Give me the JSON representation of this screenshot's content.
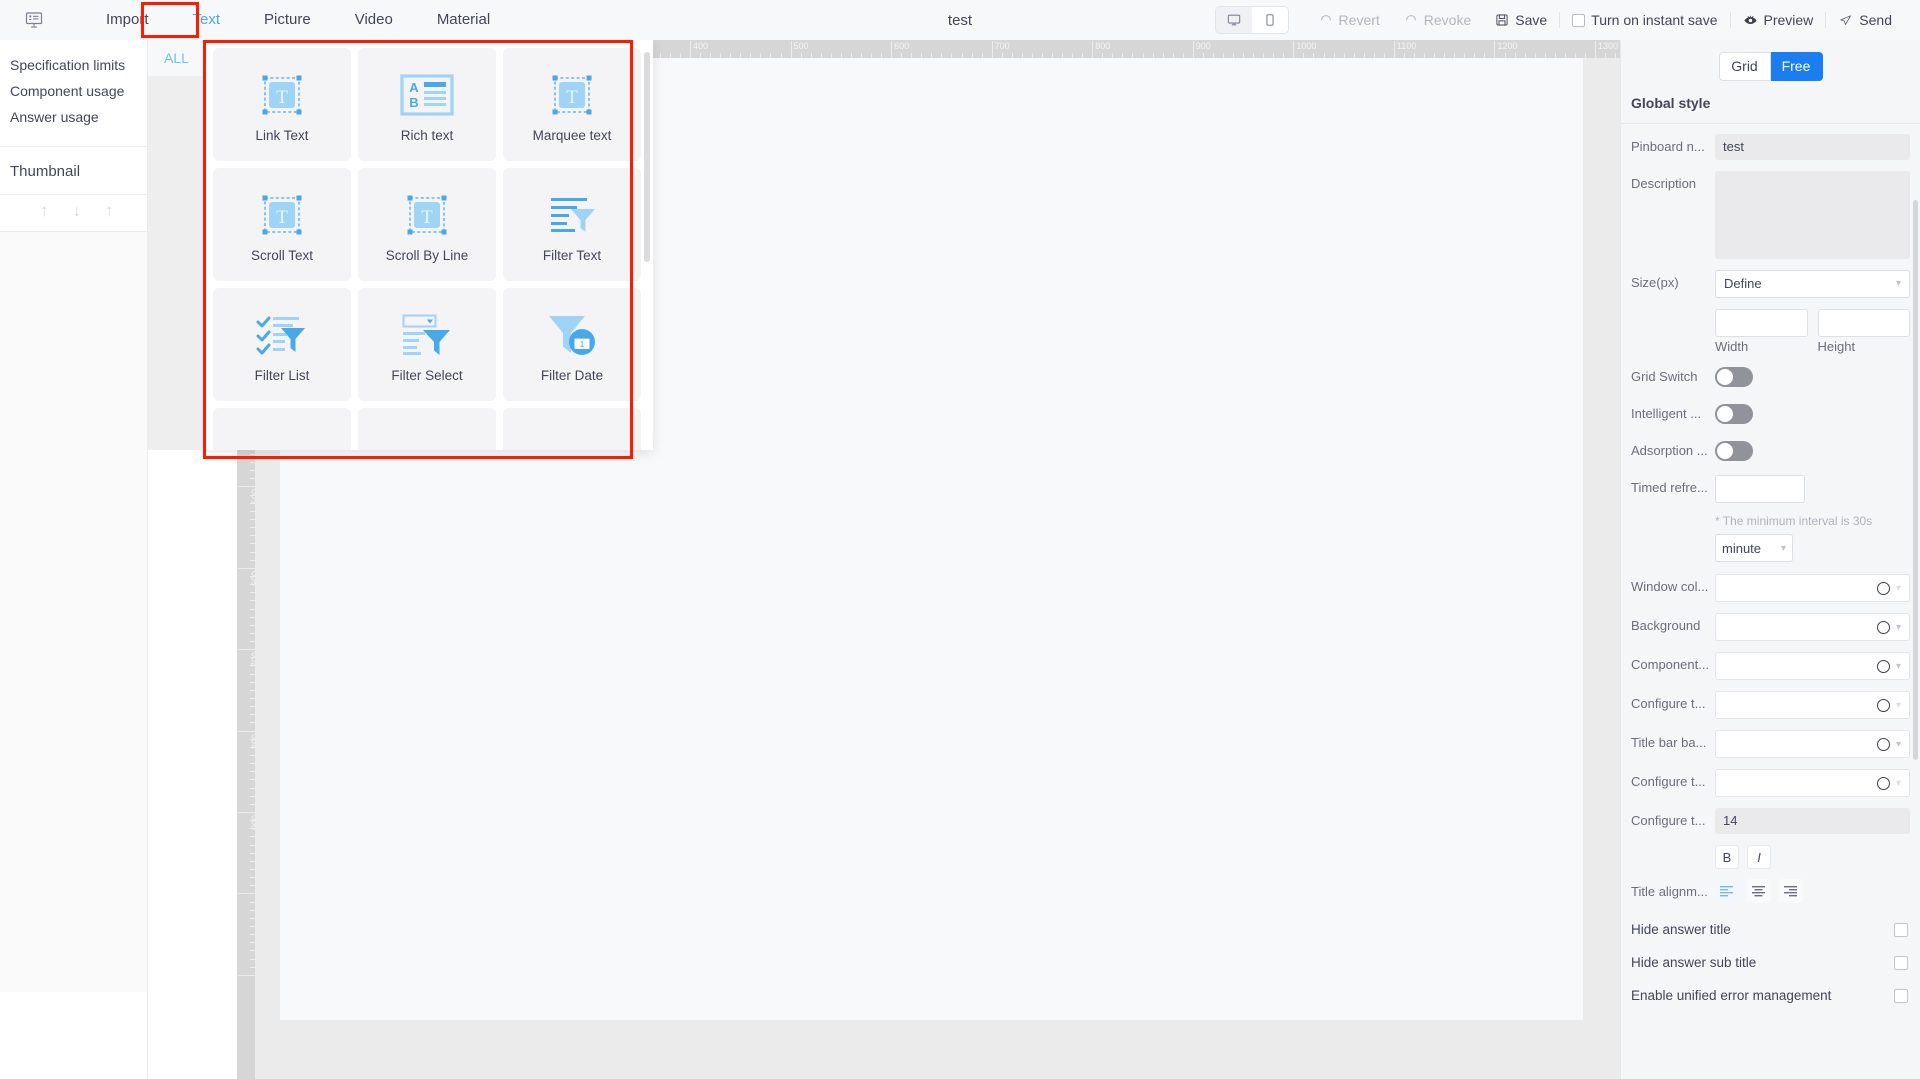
{
  "topbar": {
    "logo_icon": "presentation-screen-icon",
    "tabs": [
      {
        "label": "Import",
        "active": false
      },
      {
        "label": "Text",
        "active": true
      },
      {
        "label": "Picture",
        "active": false
      },
      {
        "label": "Video",
        "active": false
      },
      {
        "label": "Material",
        "active": false
      }
    ],
    "doc_title": "test",
    "device_desktop_icon": "monitor-icon",
    "device_mobile_icon": "phone-icon",
    "revert_label": "Revert",
    "revoke_label": "Revoke",
    "save_label": "Save",
    "instant_save_label": "Turn on instant save",
    "instant_save_checked": false,
    "preview_label": "Preview",
    "send_label": "Send",
    "accent_color": "#4aa8f0"
  },
  "left_panel": {
    "links": [
      "Specification limits",
      "Component usage",
      "Answer usage"
    ],
    "thumbnail_label": "Thumbnail",
    "tools": [
      "move-up-icon",
      "move-down-icon",
      "move-to-top-icon"
    ]
  },
  "category_column": {
    "items": [
      {
        "label": "ALL",
        "active": true
      }
    ]
  },
  "flyout": {
    "components": [
      {
        "label": "Link Text",
        "icon": "text-box-icon"
      },
      {
        "label": "Rich text",
        "icon": "rich-text-icon"
      },
      {
        "label": "Marquee text",
        "icon": "text-box-icon"
      },
      {
        "label": "Scroll Text",
        "icon": "text-box-icon"
      },
      {
        "label": "Scroll By Line",
        "icon": "text-box-icon"
      },
      {
        "label": "Filter Text",
        "icon": "filter-lines-icon"
      },
      {
        "label": "Filter List",
        "icon": "filter-checklist-icon"
      },
      {
        "label": "Filter Select",
        "icon": "filter-select-icon"
      },
      {
        "label": "Filter Date",
        "icon": "filter-date-icon"
      }
    ]
  },
  "rulers": {
    "horizontal_ticks": [
      "400",
      "500",
      "600",
      "700",
      "800",
      "900",
      "1000",
      "1100",
      "1200",
      "1300"
    ],
    "vertical_ticks": [
      "400",
      "500",
      "600",
      "700",
      "800",
      "900"
    ]
  },
  "right_panel": {
    "mode_grid": "Grid",
    "mode_free": "Free",
    "mode_selected": "Free",
    "section_title": "Global style",
    "pinboard_label": "Pinboard n...",
    "pinboard_value": "test",
    "description_label": "Description",
    "description_value": "",
    "size_label": "Size(px)",
    "size_value": "Define",
    "width_label": "Width",
    "width_value": "",
    "height_label": "Height",
    "height_value": "",
    "grid_switch_label": "Grid Switch",
    "grid_switch_on": false,
    "intelligent_label": "Intelligent ...",
    "intelligent_on": false,
    "adsorption_label": "Adsorption ...",
    "adsorption_on": false,
    "timed_refresh_label": "Timed refre...",
    "timed_refresh_value": "",
    "interval_hint": "* The minimum interval is 30s",
    "interval_unit": "minute",
    "window_color_label": "Window col...",
    "background_label": "Background",
    "component_label": "Component...",
    "configure1_label": "Configure t...",
    "titlebar_label": "Title bar ba...",
    "configure2_label": "Configure t...",
    "configure3_label": "Configure t...",
    "font_size_value": "14",
    "bold_label": "B",
    "italic_label": "I",
    "title_align_label": "Title alignm...",
    "hide_answer_title": "Hide answer title",
    "hide_answer_sub_title": "Hide answer sub title",
    "enable_unified_error": "Enable unified error management",
    "accent_color": "#1a7ef0"
  }
}
